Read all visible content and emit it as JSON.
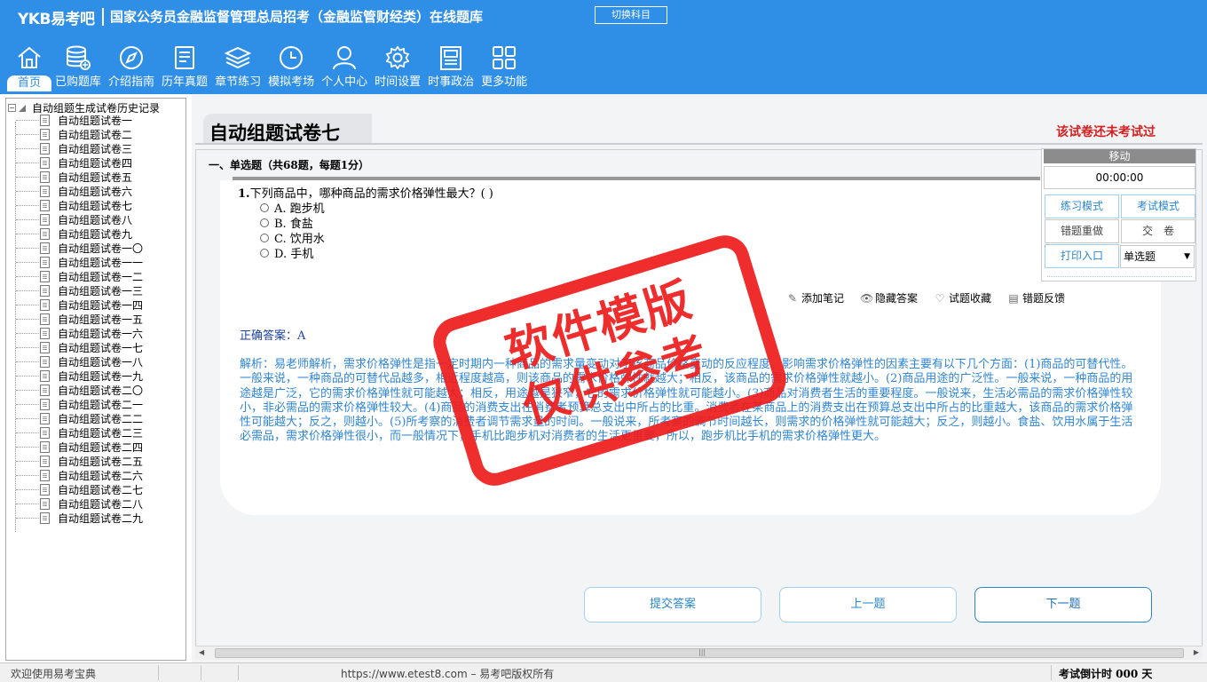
{
  "header": {
    "brand": "YKB易考吧",
    "title": "国家公务员金融监督管理总局招考（金融监管财经类）在线题库",
    "switch_subject": "切换科目",
    "nav": [
      {
        "label": "首页",
        "icon": "home-icon"
      },
      {
        "label": "已购题库",
        "icon": "database-icon"
      },
      {
        "label": "介绍指南",
        "icon": "compass-icon"
      },
      {
        "label": "历年真题",
        "icon": "document-list-icon"
      },
      {
        "label": "章节练习",
        "icon": "layers-icon"
      },
      {
        "label": "模拟考场",
        "icon": "clock-icon"
      },
      {
        "label": "个人中心",
        "icon": "user-icon"
      },
      {
        "label": "时间设置",
        "icon": "gear-icon"
      },
      {
        "label": "时事政治",
        "icon": "news-icon"
      },
      {
        "label": "更多功能",
        "icon": "grid-icon"
      }
    ]
  },
  "tree": {
    "root": "自动组题生成试卷历史记录",
    "items": [
      "自动组题试卷一",
      "自动组题试卷二",
      "自动组题试卷三",
      "自动组题试卷四",
      "自动组题试卷五",
      "自动组题试卷六",
      "自动组题试卷七",
      "自动组题试卷八",
      "自动组题试卷九",
      "自动组题试卷一〇",
      "自动组题试卷一一",
      "自动组题试卷一二",
      "自动组题试卷一三",
      "自动组题试卷一四",
      "自动组题试卷一五",
      "自动组题试卷一六",
      "自动组题试卷一七",
      "自动组题试卷一八",
      "自动组题试卷一九",
      "自动组题试卷二〇",
      "自动组题试卷二一",
      "自动组题试卷二二",
      "自动组题试卷二三",
      "自动组题试卷二四",
      "自动组题试卷二五",
      "自动组题试卷二六",
      "自动组题试卷二七",
      "自动组题试卷二八",
      "自动组题试卷二九"
    ]
  },
  "paper": {
    "title": "自动组题试卷七",
    "status": "该试卷还未考试过",
    "section": "一、单选题（共68题，每题1分）"
  },
  "question": {
    "stem_num": "1.",
    "stem": "下列商品中，哪种商品的需求价格弹性最大？( )",
    "options": [
      "A. 跑步机",
      "B. 食盐",
      "C. 饮用水",
      "D. 手机"
    ],
    "actions": [
      "添加笔记",
      "隐藏答案",
      "试题收藏",
      "错题反馈"
    ],
    "answer": "正确答案：A",
    "analysis": "解析：易老师解析，需求价格弹性是指一定时期内一种商品的需求量变动对于该商品价格变动的反应程度。影响需求价格弹性的因素主要有以下几个方面：(1)商品的可替代性。一般来说，一种商品的可替代品越多，相近程度越高，则该商品的需求价格弹性就越大；相反，该商品的需求价格弹性就越小。(2)商品用途的广泛性。一般来说，一种商品的用途越是广泛，它的需求价格弹性就可能越大；相反，用途越是狭窄，它的需求价格弹性就可能越小。(3)商品对消费者生活的重要程度。一般说来，生活必需品的需求价格弹性较小，非必需品的需求价格弹性较大。(4)商品的消费支出在消费者预算总支出中所占的比重。消费者在某商品上的消费支出在预算总支出中所占的比重越大，该商品的需求价格弹性可能越大；反之，则越小。(5)所考察的消费者调节需求量的时间。一般说来，所考察的调节时间越长，则需求的价格弹性就可能越大；反之，则越小。食盐、饮用水属于生活必需品，需求价格弹性很小，而一般情况下，手机比跑步机对消费者的生活更重要，所以，跑步机比手机的需求价格弹性更大。"
  },
  "control": {
    "move": "移动",
    "timer": "00:00:00",
    "practice_mode": "练习模式",
    "exam_mode": "考试模式",
    "redo_wrong": "错题重做",
    "submit_paper": "交　卷",
    "print": "打印入口",
    "type_select": "单选题"
  },
  "buttons": {
    "submit": "提交答案",
    "prev": "上一题",
    "next": "下一题"
  },
  "status": {
    "welcome": "欢迎使用易考宝典",
    "copyright": "https://www.etest8.com – 易考吧版权所有",
    "countdown": "考试倒计时 000 天"
  },
  "stamp": {
    "line1": "软件模版",
    "line2": "仅供参考"
  },
  "colors": {
    "header_bg": "#2f8fe6",
    "stamp_red": "#ee1c1c",
    "analysis_blue": "#2f86d6",
    "answer_blue": "#1b3fa0",
    "status_red": "#d81e1e"
  }
}
